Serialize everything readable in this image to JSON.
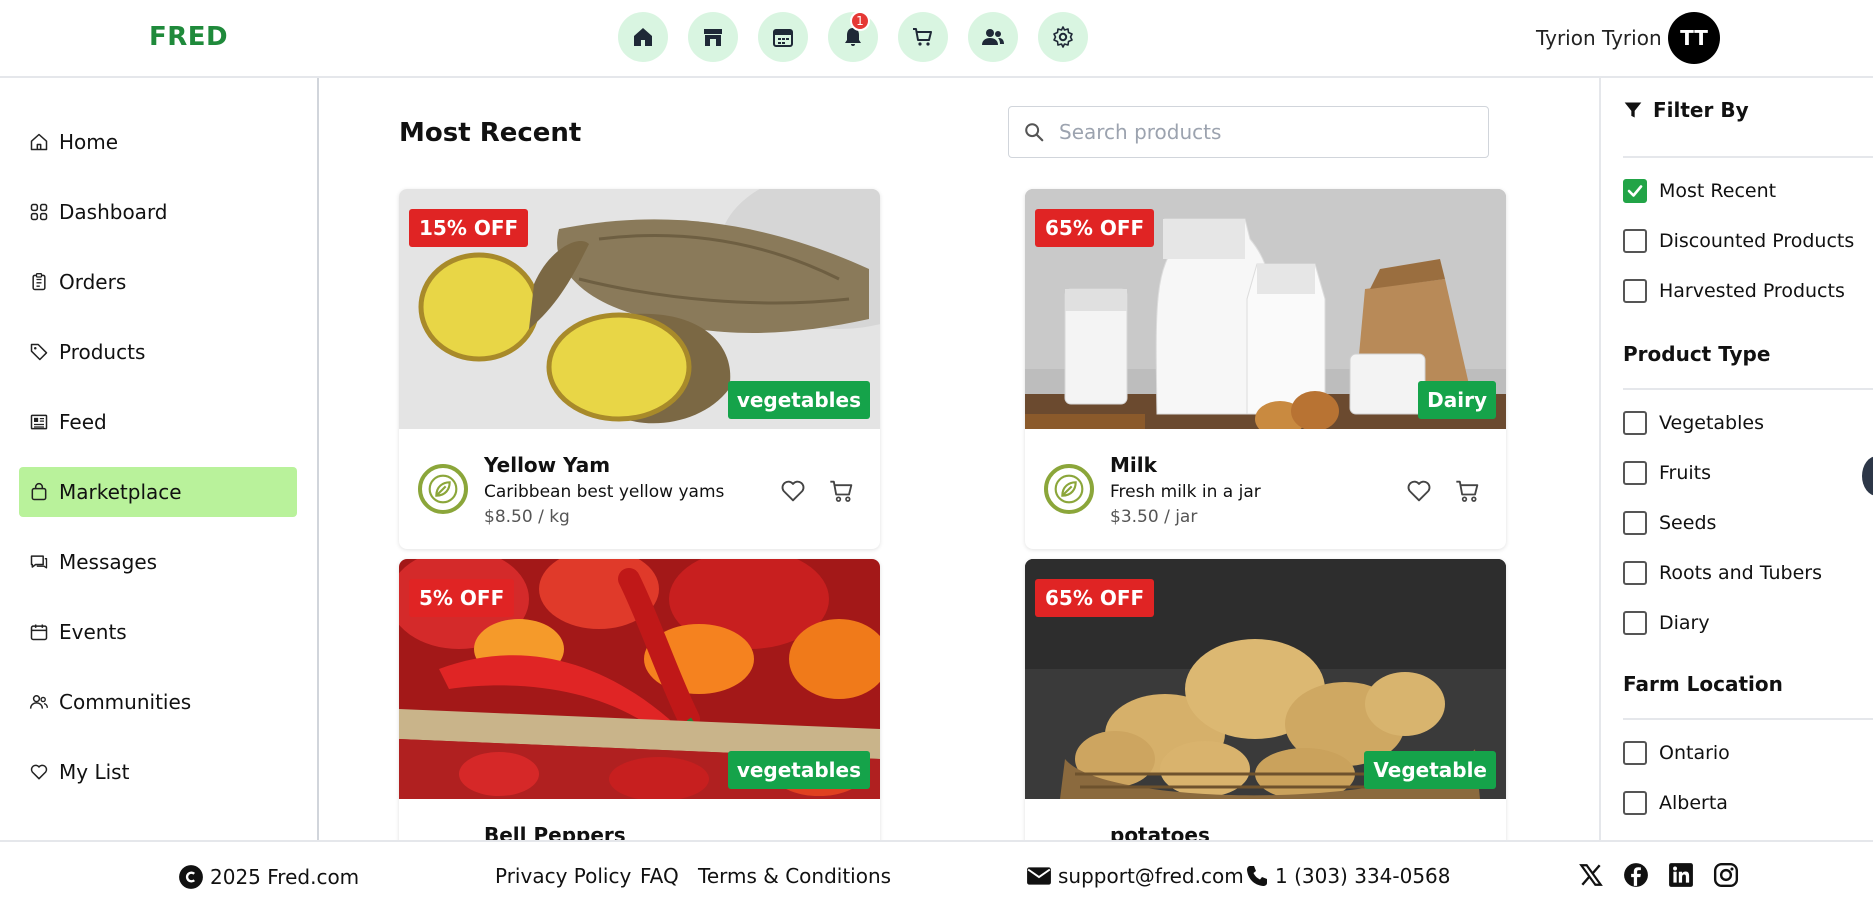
{
  "header": {
    "logo": "FRED",
    "user_name": "Tyrion Tyrion",
    "avatar_initials": "TT",
    "notification_count": "1",
    "nav_icons": [
      "home-icon",
      "store-icon",
      "calendar-icon",
      "bell-icon",
      "cart-icon",
      "users-icon",
      "gear-icon"
    ]
  },
  "sidebar": {
    "items": [
      {
        "label": "Home",
        "icon": "home-outline-icon"
      },
      {
        "label": "Dashboard",
        "icon": "grid-icon"
      },
      {
        "label": "Orders",
        "icon": "clipboard-icon"
      },
      {
        "label": "Products",
        "icon": "tag-icon"
      },
      {
        "label": "Feed",
        "icon": "newspaper-icon"
      },
      {
        "label": "Marketplace",
        "icon": "bag-icon",
        "active": true
      },
      {
        "label": "Messages",
        "icon": "chat-icon"
      },
      {
        "label": "Events",
        "icon": "calendar-outline-icon"
      },
      {
        "label": "Communities",
        "icon": "people-outline-icon"
      },
      {
        "label": "My List",
        "icon": "heart-outline-icon"
      }
    ]
  },
  "main": {
    "title": "Most Recent",
    "search_placeholder": "Search products",
    "products": [
      {
        "discount": "15% OFF",
        "category": "vegetables",
        "name": "Yellow Yam",
        "description": "Caribbean best yellow yams",
        "price": "$8.50 / kg"
      },
      {
        "discount": "65% OFF",
        "category": "Dairy",
        "name": "Milk",
        "description": "Fresh milk in a jar",
        "price": "$3.50 / jar"
      },
      {
        "discount": "5% OFF",
        "category": "vegetables",
        "name": "Bell Peppers",
        "description": "",
        "price": ""
      },
      {
        "discount": "65% OFF",
        "category": "Vegetable",
        "name": "potatoes",
        "description": "",
        "price": ""
      }
    ]
  },
  "filter": {
    "heading": "Filter By",
    "sort_options": [
      {
        "label": "Most Recent",
        "checked": true
      },
      {
        "label": "Discounted Products",
        "checked": false
      },
      {
        "label": "Harvested Products",
        "checked": false
      }
    ],
    "product_type_title": "Product Type",
    "product_types": [
      {
        "label": "Vegetables",
        "checked": false
      },
      {
        "label": "Fruits",
        "checked": false
      },
      {
        "label": "Seeds",
        "checked": false
      },
      {
        "label": "Roots and Tubers",
        "checked": false
      },
      {
        "label": "Diary",
        "checked": false
      }
    ],
    "farm_location_title": "Farm Location",
    "locations": [
      {
        "label": "Ontario",
        "checked": false
      },
      {
        "label": "Alberta",
        "checked": false
      }
    ]
  },
  "footer": {
    "copyright": "2025 Fred.com",
    "links": [
      "Privacy Policy",
      "FAQ",
      "Terms & Conditions"
    ],
    "email": "support@fred.com",
    "phone": "1 (303) 334-0568",
    "social": [
      "x-icon",
      "facebook-icon",
      "linkedin-icon",
      "instagram-icon"
    ]
  },
  "colors": {
    "brand_green": "#1f8a3b",
    "nav_bg": "#d9f5e1",
    "active_sidebar": "#b9f29b",
    "discount_red": "#e02424",
    "category_green": "#15a34a"
  }
}
